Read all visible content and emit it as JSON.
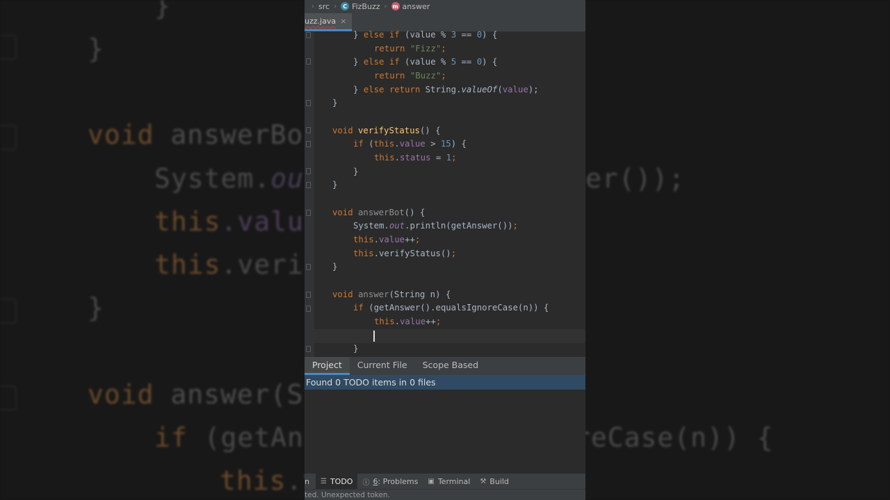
{
  "breadcrumb": {
    "src": "src",
    "class_name": "FizBuzz",
    "method": "answer"
  },
  "editor_tab": {
    "filename": "uzz.java",
    "close": "×"
  },
  "code": {
    "l1_a": "} ",
    "l1_b": "else if ",
    "l1_c": "(value % ",
    "l1_d": "3",
    "l1_e": " == ",
    "l1_f": "0",
    "l1_g": ") {",
    "l2_a": "return ",
    "l2_b": "\"Fizz\"",
    "l2_c": ";",
    "l3_a": "} ",
    "l3_b": "else if ",
    "l3_c": "(value % ",
    "l3_d": "5",
    "l3_e": " == ",
    "l3_f": "0",
    "l3_g": ") {",
    "l4_a": "return ",
    "l4_b": "\"Buzz\"",
    "l4_c": ";",
    "l5_a": "} ",
    "l5_b": "else return ",
    "l5_c": "String.",
    "l5_d": "valueOf",
    "l5_e": "(",
    "l5_f": "value",
    "l5_g": ");",
    "l6": "}",
    "l7_a": "void ",
    "l7_b": "verifyStatus",
    "l7_c": "() {",
    "l8_a": "if ",
    "l8_b": "(",
    "l8_c": "this",
    "l8_d": ".",
    "l8_e": "value",
    "l8_f": " > ",
    "l8_g": "15",
    "l8_h": ") {",
    "l9_a": "this",
    "l9_b": ".",
    "l9_c": "status",
    "l9_d": " = ",
    "l9_e": "1",
    "l9_f": ";",
    "l10": "}",
    "l11": "}",
    "l12_a": "void ",
    "l12_b": "answerBot",
    "l12_c": "() {",
    "l13_a": "System.",
    "l13_b": "out",
    "l13_c": ".println(getAnswer())",
    "l13_d": ";",
    "l14_a": "this",
    "l14_b": ".",
    "l14_c": "value",
    "l14_d": "++",
    "l14_e": ";",
    "l15_a": "this",
    "l15_b": ".verifyStatus()",
    "l15_c": ";",
    "l16": "}",
    "l17_a": "void ",
    "l17_b": "answer",
    "l17_c": "(String n) {",
    "l18_a": "if ",
    "l18_b": "(getAnswer().equalsIgnoreCase(n)) {",
    "l19_a": "this",
    "l19_b": ".",
    "l19_c": "value",
    "l19_d": "++",
    "l19_e": ";",
    "l21": "}"
  },
  "todo": {
    "tabs": [
      "Project",
      "Current File",
      "Scope Based"
    ],
    "status": "Found 0 TODO items in 0 files"
  },
  "tool_windows": {
    "run_fragment": "n",
    "todo": "TODO",
    "problems_num": "6",
    "problems": ": Problems",
    "terminal": "Terminal",
    "build": "Build"
  },
  "status_bar": {
    "message": "ted. Unexpected token."
  },
  "background": {
    "b1": "}",
    "b2": "}",
    "b3_a": "void ",
    "b3_b": "answerBo",
    "b4_a": "System.",
    "b4_b": "ou",
    "b4_c": "er());",
    "b5_a": "this",
    "b5_b": ".valu",
    "b6_a": "this",
    "b6_b": ".veri",
    "b7": "}",
    "b8_a": "void ",
    "b8_b": "answer(St",
    "b9_a": "if ",
    "b9_b": "(getAns",
    "b9_c": "reCase(n)) {",
    "b10_a": "this",
    "b10_b": ".v"
  }
}
